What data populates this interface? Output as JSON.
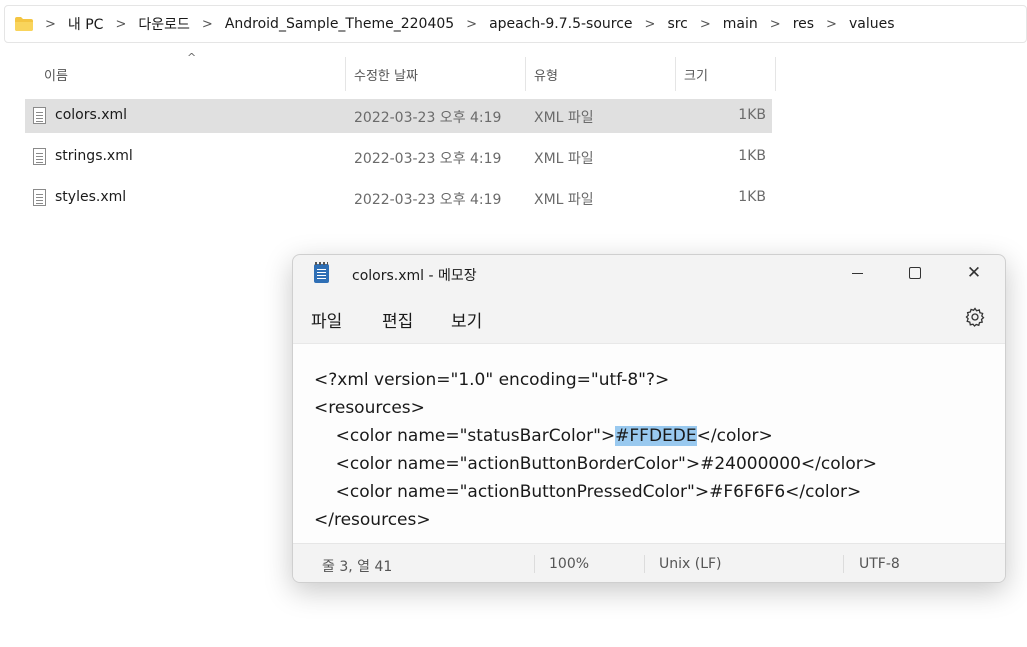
{
  "explorer": {
    "breadcrumb": [
      "내 PC",
      "다운로드",
      "Android_Sample_Theme_220405",
      "apeach-9.7.5-source",
      "src",
      "main",
      "res",
      "values"
    ],
    "columns": {
      "name": "이름",
      "date": "수정한 날짜",
      "type": "유형",
      "size": "크기"
    },
    "files": [
      {
        "name": "colors.xml",
        "date": "2022-03-23 오후 4:19",
        "type": "XML 파일",
        "size": "1KB"
      },
      {
        "name": "strings.xml",
        "date": "2022-03-23 오후 4:19",
        "type": "XML 파일",
        "size": "1KB"
      },
      {
        "name": "styles.xml",
        "date": "2022-03-23 오후 4:19",
        "type": "XML 파일",
        "size": "1KB"
      }
    ]
  },
  "notepad": {
    "title": "colors.xml - 메모장",
    "menu": {
      "file": "파일",
      "edit": "편집",
      "view": "보기"
    },
    "content": {
      "line1": "<?xml version=\"1.0\" encoding=\"utf-8\"?>",
      "line2": "<resources>",
      "line3_pre": "    <color name=\"statusBarColor\">",
      "line3_sel": "#FFDEDE",
      "line3_post": "</color>",
      "line4": "    <color name=\"actionButtonBorderColor\">#24000000</color>",
      "line5": "    <color name=\"actionButtonPressedColor\">#F6F6F6</color>",
      "line6": "</resources>"
    },
    "status": {
      "position": "줄 3, 열 41",
      "zoom": "100%",
      "line_ending": "Unix (LF)",
      "encoding": "UTF-8"
    }
  },
  "colors": {
    "selection": "#99c9ef",
    "folder": "#f4c542",
    "selected_row": "#e0e0e0"
  },
  "icons": [
    "folder-icon",
    "chevron-right-icon",
    "xml-file-icon",
    "notepad-icon",
    "minimize-icon",
    "maximize-icon",
    "close-icon",
    "settings-gear-icon",
    "sort-ascending-icon"
  ]
}
